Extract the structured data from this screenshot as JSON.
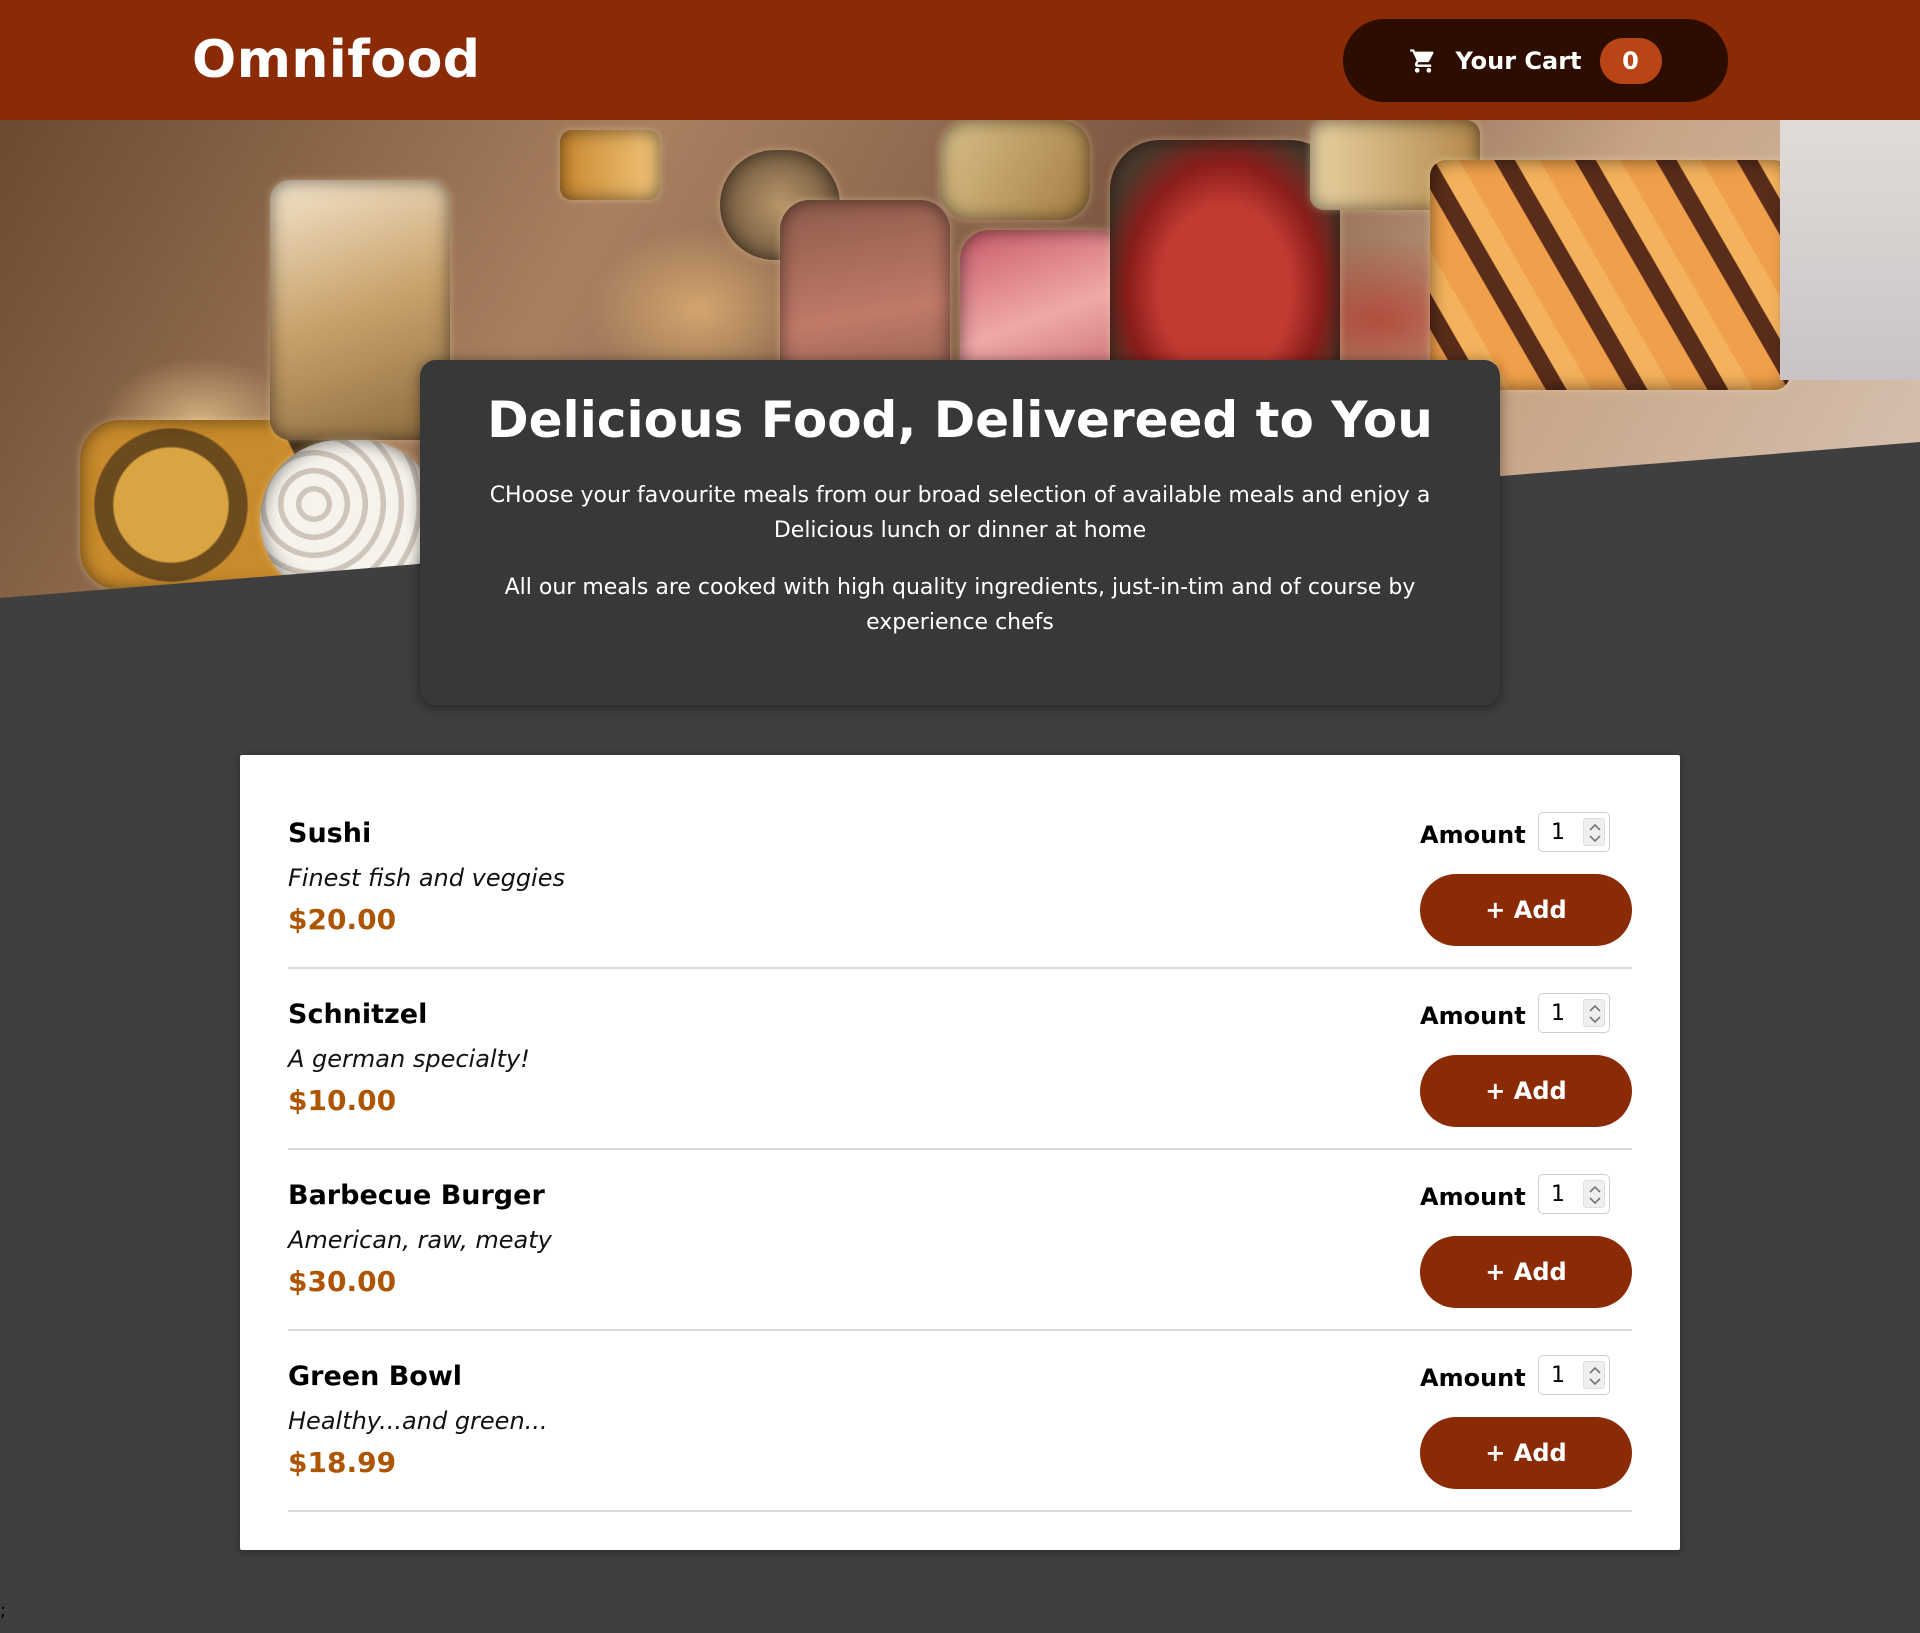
{
  "header": {
    "logo": "Omnifood",
    "cart": {
      "label": "Your Cart",
      "count": "0",
      "icon": "cart-icon"
    }
  },
  "summary": {
    "title": "Delicious Food, Delivereed to You",
    "paragraph1": "CHoose your favourite meals from our broad selection of available meals and enjoy a Delicious lunch or dinner at home",
    "paragraph2": "All our meals are cooked with high quality ingredients, just-in-tim and of course by experience chefs"
  },
  "meals": [
    {
      "name": "Sushi",
      "description": "Finest fish and veggies",
      "price": "$20.00",
      "amount_label": "Amount",
      "amount": "1",
      "add_label": "+ Add"
    },
    {
      "name": "Schnitzel",
      "description": "A german specialty!",
      "price": "$10.00",
      "amount_label": "Amount",
      "amount": "1",
      "add_label": "+ Add"
    },
    {
      "name": "Barbecue Burger",
      "description": "American, raw, meaty",
      "price": "$30.00",
      "amount_label": "Amount",
      "amount": "1",
      "add_label": "+ Add"
    },
    {
      "name": "Green Bowl",
      "description": "Healthy...and green...",
      "price": "$18.99",
      "amount_label": "Amount",
      "amount": "1",
      "add_label": "+ Add"
    }
  ],
  "footer_stray": ";",
  "colors": {
    "header_bg": "#8a2b06",
    "cart_bg": "#2c0d00",
    "badge_bg": "#b94517",
    "page_bg": "#3f3f3f",
    "summary_bg": "#383838",
    "price": "#ad5502",
    "button_bg": "#8a2b06"
  }
}
